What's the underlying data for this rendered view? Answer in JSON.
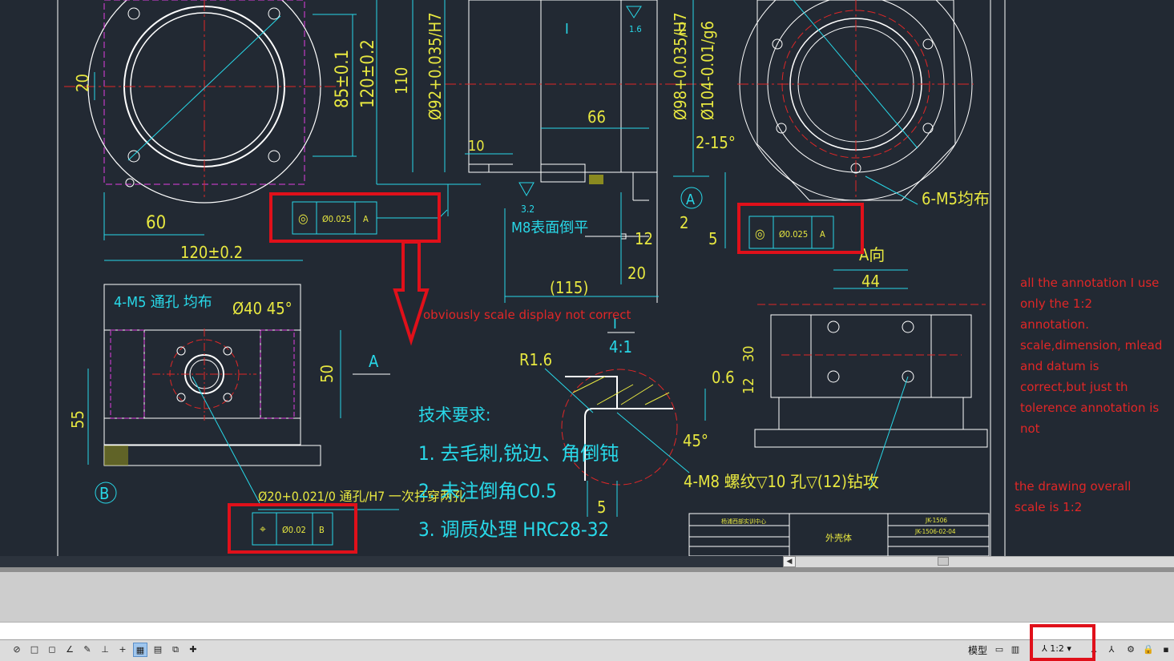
{
  "drawing": {
    "dims_left": [
      "20",
      "60",
      "85±0.1",
      "120±0.2",
      "120±0.2",
      "4-M5 通孔 均布",
      "Ø40 45°",
      "55",
      "50",
      "A",
      "B"
    ],
    "dims_center": [
      "110",
      "Ø92+0.035/H7",
      "66",
      "10",
      "3.2",
      "M8表面倒平",
      "Ø98+0.035/H7",
      "Ø104-0.01/g6",
      "2",
      "2-15°",
      "A",
      "1.6",
      "I",
      "2",
      "12",
      "20",
      "(115)",
      "5"
    ],
    "dims_right": [
      "6-M5均布",
      "A向",
      "44",
      "30",
      "12"
    ],
    "detail": {
      "scale_label": "I",
      "scale": "4:1",
      "r": "R1.6",
      "gap": "0.6",
      "angle": "45°",
      "dim5": "5",
      "thread": "4-M8 螺纹▽10 孔▽(12)钻攻"
    },
    "bore_note": "Ø20+0.021/0 通孔/H7 一次打穿两孔",
    "tech_title": "技术要求:",
    "tech_items": [
      "1. 去毛刺,锐边、角倒钝",
      "2. 未注倒角C0.5",
      "3. 调质处理 HRC28-32"
    ],
    "tol_frames": [
      {
        "sym": "◎",
        "val": "Ø0.025",
        "datum": "A"
      },
      {
        "sym": "◎",
        "val": "Ø0.025",
        "datum": "A"
      },
      {
        "sym": "⌖",
        "val": "Ø0.02",
        "datum": "B"
      }
    ],
    "title_block": {
      "part": "外壳体",
      "code1": "JK-1506",
      "code2": "JK-1506-02-04",
      "header": "杨浦西部实训中心"
    }
  },
  "annotations": {
    "scale_note": "obviously scale display not correct",
    "note_lines": [
      "all the annotation I use",
      "only the 1:2",
      "annotation.",
      "scale,dimension, mlead",
      "and datum is",
      "correct,but just th",
      "tolerence annotation is",
      "not"
    ],
    "note2_lines": [
      "the drawing overall",
      "scale is 1:2"
    ]
  },
  "statusbar": {
    "model_label": "模型",
    "annotation_scale": "1:2"
  }
}
